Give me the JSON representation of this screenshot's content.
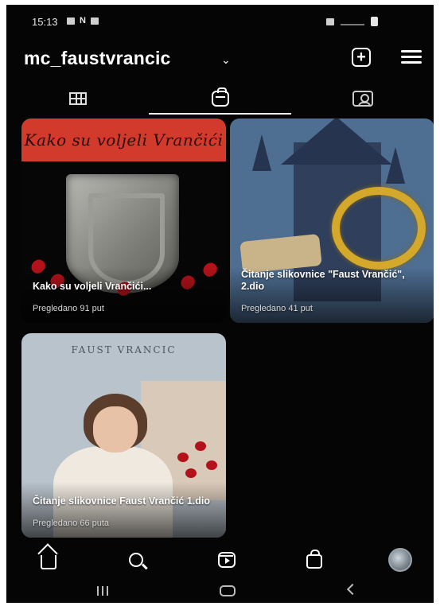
{
  "status_bar": {
    "time": "15:13",
    "left_icons": [
      "gallery-notification-icon",
      "n-notification-icon",
      "mail-notification-icon"
    ],
    "right_icons": [
      "alarm-icon",
      "signal-icon",
      "battery-icon"
    ]
  },
  "header": {
    "username": "mc_faustvrancic",
    "chevron": "⌄",
    "add_icon": "+",
    "menu_icon": "hamburger-menu-icon"
  },
  "tabs": [
    {
      "name": "grid",
      "icon": "grid-icon",
      "active": false
    },
    {
      "name": "reels",
      "icon": "reels-icon",
      "active": true
    },
    {
      "name": "tagged",
      "icon": "tagged-icon",
      "active": false
    }
  ],
  "reels": [
    {
      "banner_text": "Kako su voljeli Vrančići",
      "title": "Kako su voljeli Vrančići...",
      "views": "Pregledano 91 put"
    },
    {
      "title": "Čitanje slikovnice \"Faust Vrančić\", 2.dio",
      "views": "Pregledano 41 put"
    },
    {
      "heading": "FAUST VRANCIC",
      "title": "Čitanje slikovnice Faust Vrančić 1.dio",
      "views": "Pregledano 66 puta"
    }
  ],
  "bottom_nav": [
    "home-icon",
    "search-icon",
    "reels-icon",
    "shop-icon",
    "profile-avatar"
  ],
  "system_nav": [
    "recents-icon",
    "home-pill-icon",
    "back-icon"
  ],
  "colors": {
    "background": "#050505",
    "banner_red": "#d23a2c",
    "text_primary": "#ffffff",
    "text_secondary": "#d8d8d8"
  }
}
